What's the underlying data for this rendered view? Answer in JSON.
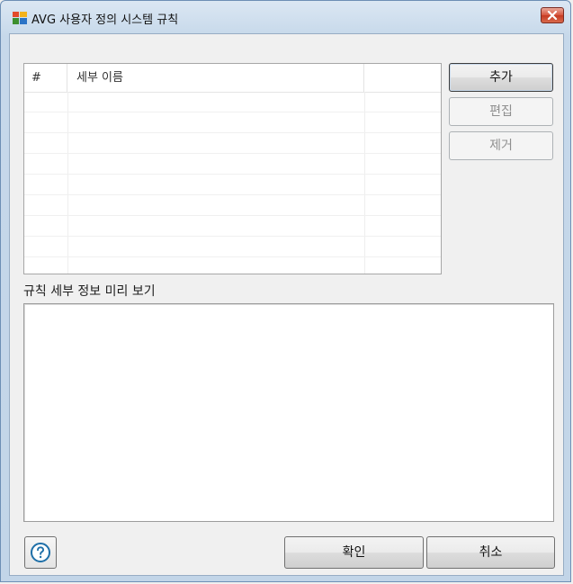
{
  "window": {
    "title": "AVG 사용자 정의 시스템 규칙",
    "close_icon": "close-icon"
  },
  "list": {
    "columns": [
      "#",
      "세부 이름",
      ""
    ],
    "rows": []
  },
  "buttons": {
    "add": "추가",
    "edit": "편집",
    "remove": "제거",
    "ok": "확인",
    "cancel": "취소",
    "help_icon": "help-icon"
  },
  "preview": {
    "label": "규칙 세부 정보 미리 보기",
    "content": ""
  },
  "colors": {
    "close_button": "#c53a22",
    "titlebar": "#c6d8ea",
    "help_icon": "#1e6fa8"
  }
}
